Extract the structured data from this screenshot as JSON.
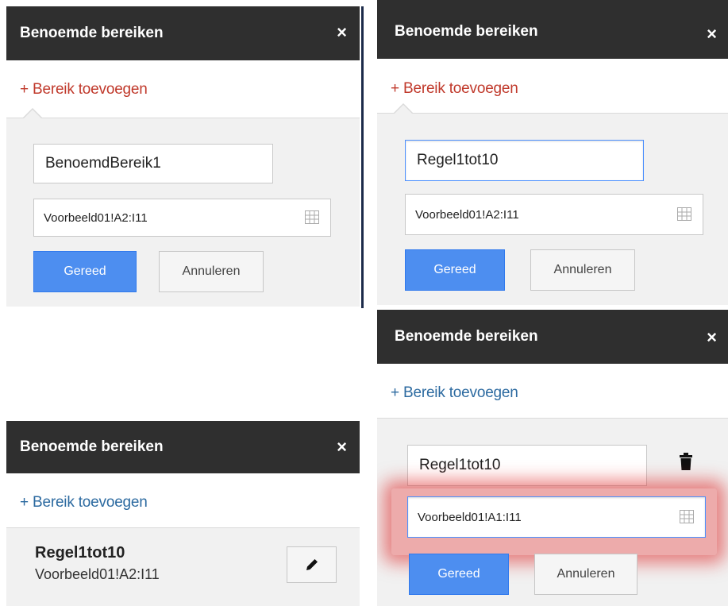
{
  "panels": [
    {
      "title": "Benoemde bereiken",
      "close_icon": "×",
      "add_label": "+ Bereik toevoegen",
      "name_value": "BenoemdBereik1",
      "range_value": "Voorbeeld01!A2:I11",
      "done_label": "Gereed",
      "cancel_label": "Annuleren"
    },
    {
      "title": "Benoemde bereiken",
      "close_icon": "×",
      "add_label": "+ Bereik toevoegen",
      "name_value": "Regel1tot10",
      "range_value": "Voorbeeld01!A2:I11",
      "done_label": "Gereed",
      "cancel_label": "Annuleren"
    },
    {
      "title": "Benoemde bereiken",
      "close_icon": "×",
      "add_label": "+ Bereik toevoegen",
      "item_name": "Regel1tot10",
      "item_range": "Voorbeeld01!A2:I11"
    },
    {
      "title": "Benoemde bereiken",
      "close_icon": "×",
      "add_label": "+ Bereik toevoegen",
      "name_value": "Regel1tot10",
      "range_value": "Voorbeeld01!A1:I11",
      "done_label": "Gereed",
      "cancel_label": "Annuleren"
    }
  ],
  "colors": {
    "header_bg": "#2f2f2f",
    "add_link_red": "#c0392b",
    "add_link_blue": "#2c6aa0",
    "primary_button": "#4d8ef0",
    "focus_border": "#4d90fe",
    "highlight_glow": "#e02020"
  },
  "icons": [
    "close-icon",
    "grid-icon",
    "trash-icon",
    "pencil-icon"
  ]
}
